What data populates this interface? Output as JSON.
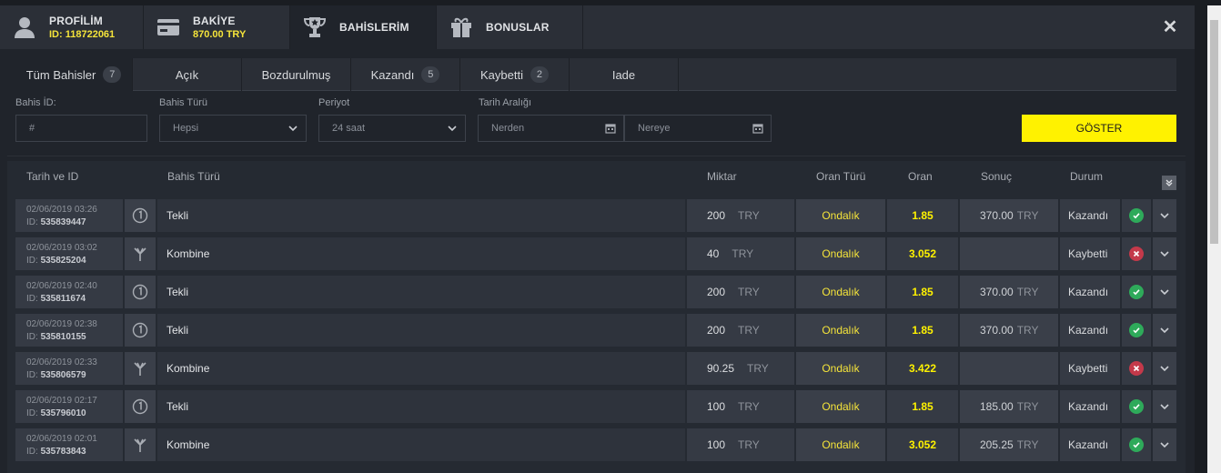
{
  "header": {
    "tabs": [
      {
        "title": "PROFİLİM",
        "sub": "ID: 118722061",
        "icon": "user-icon"
      },
      {
        "title": "BAKİYE",
        "sub": "870.00 TRY",
        "icon": "wallet-icon"
      },
      {
        "title": "BAHİSLERİM",
        "sub": "",
        "icon": "trophy-icon"
      },
      {
        "title": "BONUSLAR",
        "sub": "",
        "icon": "gift-icon"
      }
    ],
    "close_glyph": "✕"
  },
  "filter_tabs": [
    {
      "label": "Tüm Bahisler",
      "count": "7"
    },
    {
      "label": "Açık",
      "count": ""
    },
    {
      "label": "Bozdurulmuş",
      "count": ""
    },
    {
      "label": "Kazandı",
      "count": "5"
    },
    {
      "label": "Kaybetti",
      "count": "2"
    },
    {
      "label": "Iade",
      "count": ""
    }
  ],
  "filters": {
    "bet_id_label": "Bahis İD:",
    "bet_id_placeholder": "#",
    "bet_type_label": "Bahis Türü",
    "bet_type_value": "Hepsi",
    "period_label": "Periyot",
    "period_value": "24 saat",
    "date_range_label": "Tarih Aralığı",
    "from_placeholder": "Nerden",
    "to_placeholder": "Nereye",
    "show_button": "GÖSTER"
  },
  "table": {
    "headers": {
      "date_id": "Tarih ve ID",
      "bet_type": "Bahis Türü",
      "amount": "Miktar",
      "odds_type": "Oran Türü",
      "odds": "Oran",
      "result": "Sonuç",
      "status": "Durum"
    },
    "rows": [
      {
        "date": "02/06/2019 03:26",
        "id_prefix": "ID:",
        "id": "535839447",
        "kind": "single",
        "type": "Tekli",
        "amount": "200",
        "currency": "TRY",
        "odds_type": "Ondalık",
        "odds": "1.85",
        "result": "370.00",
        "result_currency": "TRY",
        "status": "Kazandı",
        "won": true
      },
      {
        "date": "02/06/2019 03:02",
        "id_prefix": "ID:",
        "id": "535825204",
        "kind": "combo",
        "type": "Kombine",
        "amount": "40",
        "currency": "TRY",
        "odds_type": "Ondalık",
        "odds": "3.052",
        "result": "",
        "result_currency": "",
        "status": "Kaybetti",
        "won": false
      },
      {
        "date": "02/06/2019 02:40",
        "id_prefix": "ID:",
        "id": "535811674",
        "kind": "single",
        "type": "Tekli",
        "amount": "200",
        "currency": "TRY",
        "odds_type": "Ondalık",
        "odds": "1.85",
        "result": "370.00",
        "result_currency": "TRY",
        "status": "Kazandı",
        "won": true
      },
      {
        "date": "02/06/2019 02:38",
        "id_prefix": "ID:",
        "id": "535810155",
        "kind": "single",
        "type": "Tekli",
        "amount": "200",
        "currency": "TRY",
        "odds_type": "Ondalık",
        "odds": "1.85",
        "result": "370.00",
        "result_currency": "TRY",
        "status": "Kazandı",
        "won": true
      },
      {
        "date": "02/06/2019 02:33",
        "id_prefix": "ID:",
        "id": "535806579",
        "kind": "combo",
        "type": "Kombine",
        "amount": "90.25",
        "currency": "TRY",
        "odds_type": "Ondalık",
        "odds": "3.422",
        "result": "",
        "result_currency": "",
        "status": "Kaybetti",
        "won": false
      },
      {
        "date": "02/06/2019 02:17",
        "id_prefix": "ID:",
        "id": "535796010",
        "kind": "single",
        "type": "Tekli",
        "amount": "100",
        "currency": "TRY",
        "odds_type": "Ondalık",
        "odds": "1.85",
        "result": "185.00",
        "result_currency": "TRY",
        "status": "Kazandı",
        "won": true
      },
      {
        "date": "02/06/2019 02:01",
        "id_prefix": "ID:",
        "id": "535783843",
        "kind": "combo",
        "type": "Kombine",
        "amount": "100",
        "currency": "TRY",
        "odds_type": "Ondalık",
        "odds": "3.052",
        "result": "205.25",
        "result_currency": "TRY",
        "status": "Kazandı",
        "won": true
      }
    ]
  },
  "colors": {
    "accent": "#fff200",
    "win": "#2eaa5a",
    "loss": "#c4394a"
  }
}
